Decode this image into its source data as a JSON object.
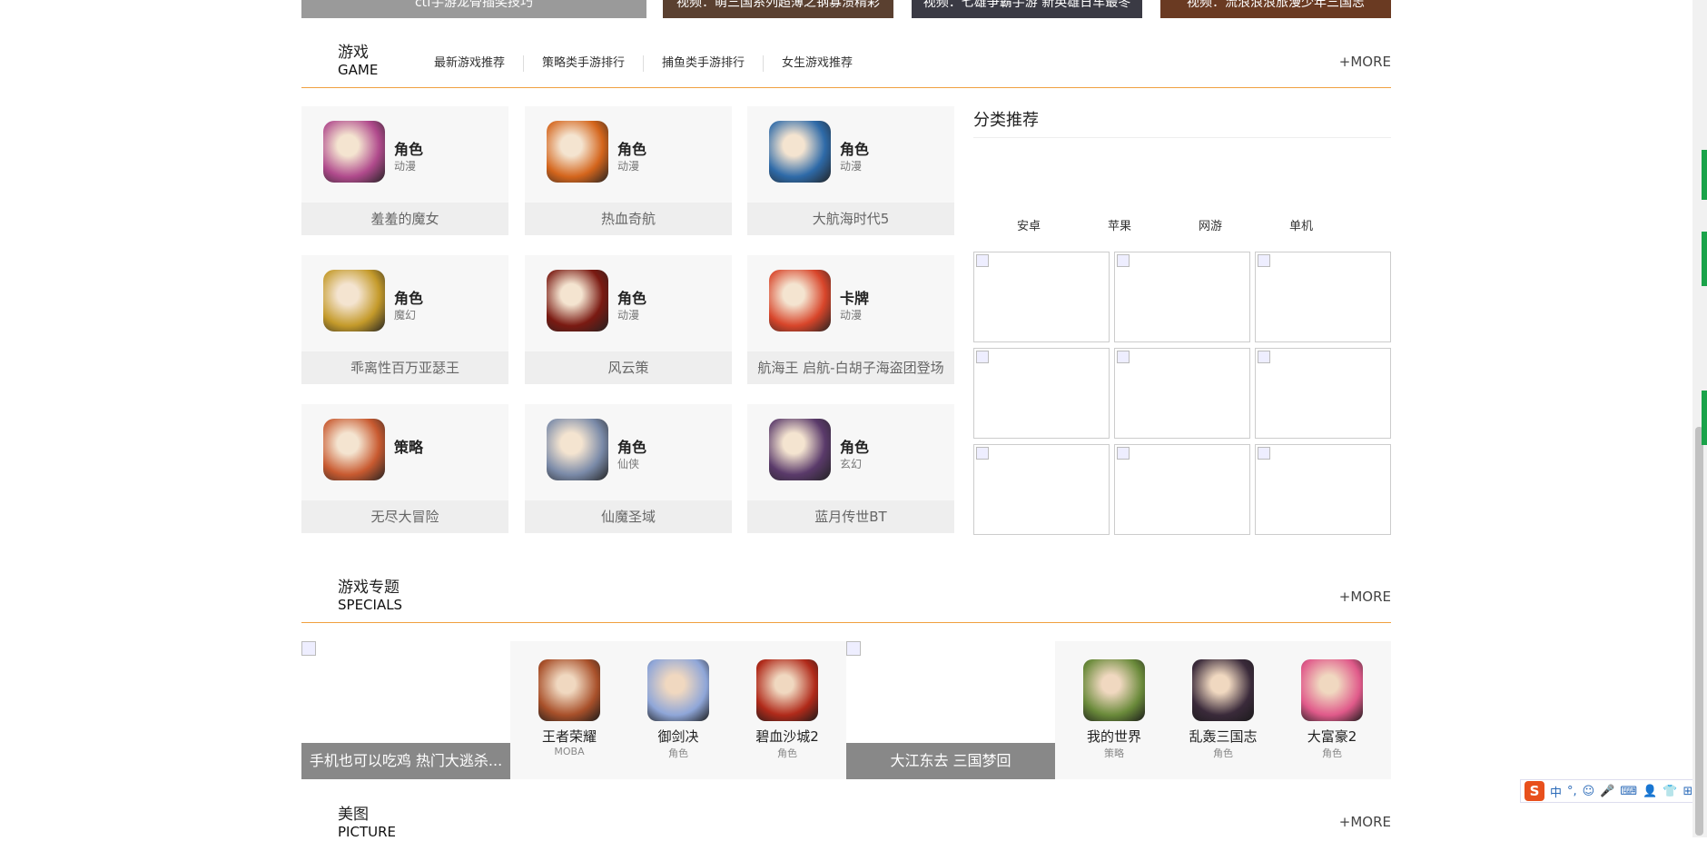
{
  "top_strip": [
    "ctf手游龙骨插奖技巧",
    "视频：萌三国系列超薄之钢寡溃精彩",
    "视频：七雄争霸手游 新英雄日车最冬",
    "视频：流浪浪浪旅漫少年三国志"
  ],
  "games_section": {
    "title_cn": "游戏",
    "title_en": "GAME",
    "tabs": [
      "最新游戏推荐",
      "策略类手游排行",
      "捕鱼类手游排行",
      "女生游戏推荐"
    ],
    "more": "+MORE",
    "cards": [
      {
        "cat": "角色",
        "sub": "动漫",
        "name": "羞羞的魔女",
        "color": "#b04a8c"
      },
      {
        "cat": "角色",
        "sub": "动漫",
        "name": "热血奇航",
        "color": "#d4651c"
      },
      {
        "cat": "角色",
        "sub": "动漫",
        "name": "大航海时代5",
        "color": "#2e6aa8"
      },
      {
        "cat": "角色",
        "sub": "魔幻",
        "name": "乖离性百万亚瑟王",
        "color": "#c49a2a"
      },
      {
        "cat": "角色",
        "sub": "动漫",
        "name": "风云策",
        "color": "#7a1a12"
      },
      {
        "cat": "卡牌",
        "sub": "动漫",
        "name": "航海王 启航-白胡子海盗团登场",
        "color": "#d8452a"
      },
      {
        "cat": "策略",
        "sub": "",
        "name": "无尽大冒险",
        "color": "#c85a30"
      },
      {
        "cat": "角色",
        "sub": "仙侠",
        "name": "仙魔圣域",
        "color": "#7a8aa8"
      },
      {
        "cat": "角色",
        "sub": "玄幻",
        "name": "蓝月传世BT",
        "color": "#5a3a6a"
      }
    ]
  },
  "category_panel": {
    "title": "分类推荐",
    "tabs": [
      "安卓",
      "苹果",
      "网游",
      "单机"
    ]
  },
  "specials_section": {
    "title_cn": "游戏专题",
    "title_en": "SPECIALS",
    "more": "+MORE",
    "left": {
      "caption": "手机也可以吃鸡 热门大逃杀...",
      "games": [
        {
          "name": "王者荣耀",
          "cat": "MOBA",
          "color": "#a8502a"
        },
        {
          "name": "御剑决",
          "cat": "角色",
          "color": "#8fa6d8"
        },
        {
          "name": "碧血沙城2",
          "cat": "角色",
          "color": "#b02a1a"
        }
      ]
    },
    "right": {
      "caption": "大江东去 三国梦回",
      "games": [
        {
          "name": "我的世界",
          "cat": "策略",
          "color": "#6a8a3a"
        },
        {
          "name": "乱轰三国志",
          "cat": "角色",
          "color": "#3a2a3a"
        },
        {
          "name": "大富豪2",
          "cat": "角色",
          "color": "#e05a8a"
        }
      ]
    }
  },
  "picture_section": {
    "title_cn": "美图",
    "title_en": "PICTURE",
    "more": "+MORE"
  },
  "ime": {
    "logo": "S",
    "items": [
      "中",
      "°,",
      "☺",
      "🎤",
      "⌨",
      "👤",
      "👕",
      "⊞"
    ]
  }
}
